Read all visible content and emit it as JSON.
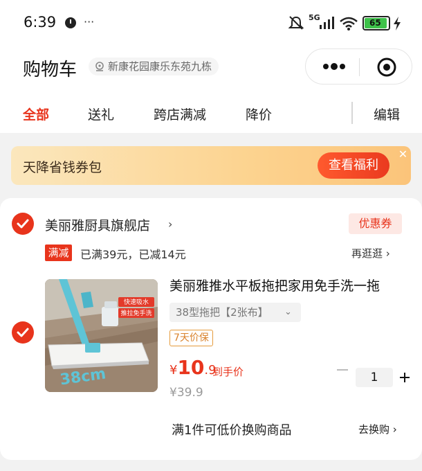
{
  "status_bar": {
    "time": "6:39",
    "more": "···",
    "battery": "65",
    "network": "5G"
  },
  "header": {
    "title": "购物车",
    "address": "新康花园康乐东苑九栋"
  },
  "tabs": [
    {
      "label": "全部",
      "active": true
    },
    {
      "label": "送礼",
      "active": false
    },
    {
      "label": "跨店满减",
      "active": false
    },
    {
      "label": "降价",
      "active": false
    }
  ],
  "edit_label": "编辑",
  "banner": {
    "text": "天降省钱券包",
    "button": "查看福利",
    "close": "✕"
  },
  "store": {
    "name": "美丽雅厨具旗舰店",
    "arrow": "›",
    "coupon": "优惠券",
    "promo_tag": "满减",
    "promo_text": "已满39元，已减14元",
    "promo_link": "再逛逛 ›"
  },
  "product": {
    "title": "美丽雅推水平板拖把家用免手洗一拖",
    "spec": "38型拖把【2张布】",
    "spec_arrow": "⌄",
    "guarantee": "7天价保",
    "image_labels": [
      "快速吸水",
      "推拉免手洗",
      "38cm"
    ],
    "price_symbol": "¥",
    "price_int": "10",
    "price_dec": ".9",
    "price_note": "到手价",
    "original_price": "¥39.9",
    "quantity": "1"
  },
  "swap": {
    "text": "满1件可低价换购商品",
    "link": "去换购 ›"
  },
  "colors": {
    "accent": "#e8341c",
    "background": "#f2f2f2"
  }
}
